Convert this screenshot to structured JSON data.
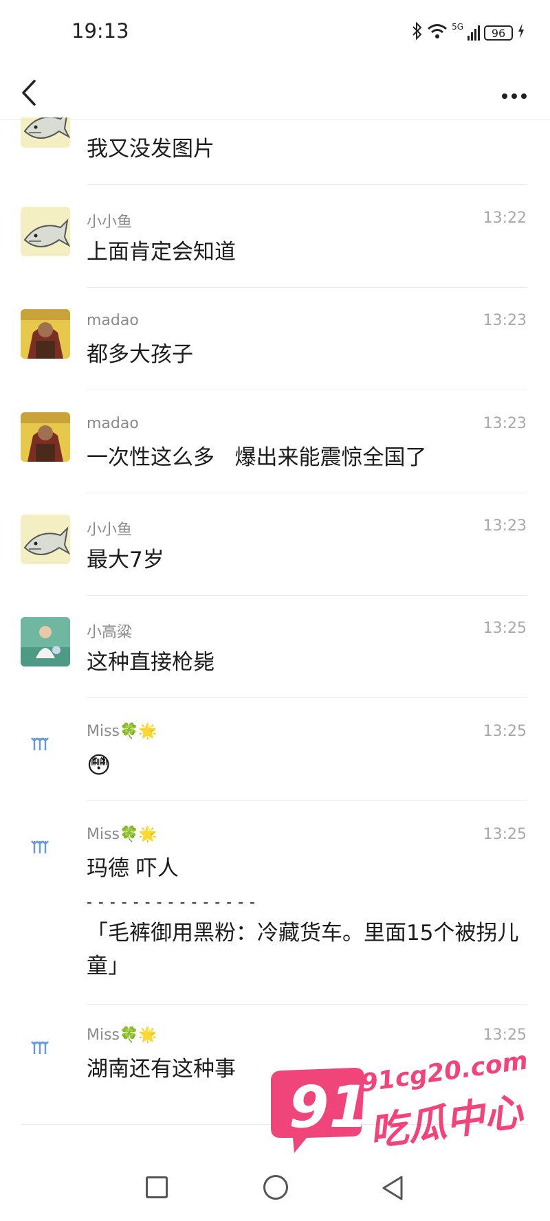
{
  "status": {
    "time": "19:13",
    "network": "5G",
    "battery": "96"
  },
  "messages": [
    {
      "sender": "",
      "time": "",
      "text": "我又没发图片",
      "avatar": "fish-avatar"
    },
    {
      "sender": "小小鱼",
      "time": "13:22",
      "text": "上面肯定会知道",
      "avatar": "fish-avatar"
    },
    {
      "sender": "madao",
      "time": "13:23",
      "text": "都多大孩子",
      "avatar": "madao-avatar"
    },
    {
      "sender": "madao",
      "time": "13:23",
      "text": "一次性这么多   爆出来能震惊全国了",
      "avatar": "madao-avatar"
    },
    {
      "sender": "小小鱼",
      "time": "13:23",
      "text": "最大7岁",
      "avatar": "fish-avatar"
    },
    {
      "sender": "小高粱",
      "time": "13:25",
      "text": "这种直接枪毙",
      "avatar": "photo-avatar"
    },
    {
      "sender": "Miss🍀🌟",
      "time": "13:25",
      "text": "😳",
      "avatar": "glasses-avatar"
    },
    {
      "sender": "Miss🍀🌟",
      "time": "13:25",
      "text": "玛德 吓人",
      "divider_line": "- - - - - - - - - - - - - - -",
      "quote": "「毛裤御用黑粉：冷藏货车。里面15个被拐儿童」",
      "avatar": "glasses-avatar"
    },
    {
      "sender": "Miss🍀🌟",
      "time": "13:25",
      "text": "湖南还有这种事",
      "avatar": "glasses-avatar"
    }
  ],
  "watermark": {
    "number": "91",
    "url": "91cg20.com",
    "name": "吃瓜中心",
    "color": "#f0457a"
  },
  "colors": {
    "sender": "#8a8a8a",
    "time": "#a8a8a8",
    "text": "#1c1c1c"
  }
}
